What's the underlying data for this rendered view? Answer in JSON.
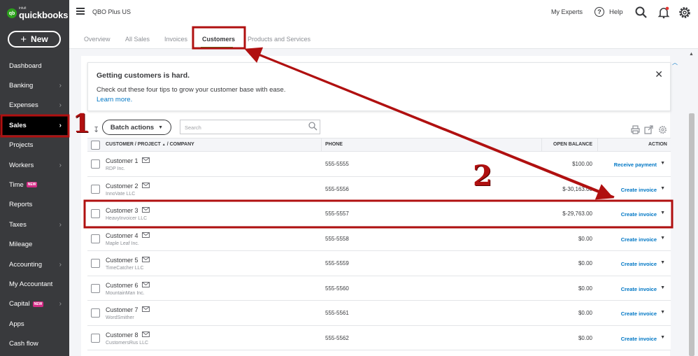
{
  "brand": {
    "logo_small": "intuit",
    "logo_big": "quickbooks"
  },
  "sidebar": {
    "new_label": "New",
    "items": [
      {
        "label": "Dashboard",
        "chevron": false,
        "badge": ""
      },
      {
        "label": "Banking",
        "chevron": true,
        "badge": ""
      },
      {
        "label": "Expenses",
        "chevron": true,
        "badge": ""
      },
      {
        "label": "Sales",
        "chevron": true,
        "badge": "",
        "active": true
      },
      {
        "label": "Projects",
        "chevron": false,
        "badge": ""
      },
      {
        "label": "Workers",
        "chevron": true,
        "badge": ""
      },
      {
        "label": "Time",
        "chevron": false,
        "badge": "NEW"
      },
      {
        "label": "Reports",
        "chevron": false,
        "badge": ""
      },
      {
        "label": "Taxes",
        "chevron": true,
        "badge": ""
      },
      {
        "label": "Mileage",
        "chevron": false,
        "badge": ""
      },
      {
        "label": "Accounting",
        "chevron": true,
        "badge": ""
      },
      {
        "label": "My Accountant",
        "chevron": false,
        "badge": ""
      },
      {
        "label": "Capital",
        "chevron": true,
        "badge": "NEW"
      },
      {
        "label": "Apps",
        "chevron": false,
        "badge": ""
      },
      {
        "label": "Cash flow",
        "chevron": false,
        "badge": ""
      }
    ]
  },
  "header": {
    "company_name": "QBO Plus US",
    "my_experts": "My Experts",
    "help_label": "Help",
    "help_glyph": "?"
  },
  "tabs": [
    "Overview",
    "All Sales",
    "Invoices",
    "Customers",
    "Products and Services"
  ],
  "banner": {
    "title": "Getting customers is hard.",
    "body": "Check out these four tips to grow your customer base with ease.",
    "link": "Learn more.",
    "close": "✕"
  },
  "toolbar": {
    "batch_actions": "Batch actions",
    "search_placeholder": "Search"
  },
  "table": {
    "headers": {
      "customer": "CUSTOMER / PROJECT",
      "sort_glyph": "▲",
      "company": "/ COMPANY",
      "phone": "PHONE",
      "balance": "OPEN BALANCE",
      "action": "ACTION"
    },
    "rows": [
      {
        "name": "Customer 1",
        "company": "RDP Inc.",
        "phone": "555-5555",
        "balance": "$100.00",
        "action": "Receive payment"
      },
      {
        "name": "Customer 2",
        "company": "InnoVate LLC",
        "phone": "555-5556",
        "balance": "$-30,163.00",
        "action": "Create invoice"
      },
      {
        "name": "Customer 3",
        "company": "HeavyInvoicer LLC",
        "phone": "555-5557",
        "balance": "$-29,763.00",
        "action": "Create invoice"
      },
      {
        "name": "Customer 4",
        "company": "Maple Leaf Inc.",
        "phone": "555-5558",
        "balance": "$0.00",
        "action": "Create invoice"
      },
      {
        "name": "Customer 5",
        "company": "TimeCatcher LLC",
        "phone": "555-5559",
        "balance": "$0.00",
        "action": "Create invoice"
      },
      {
        "name": "Customer 6",
        "company": "MountainMan Inc.",
        "phone": "555-5560",
        "balance": "$0.00",
        "action": "Create invoice"
      },
      {
        "name": "Customer 7",
        "company": "WordSmither",
        "phone": "555-5561",
        "balance": "$0.00",
        "action": "Create invoice"
      },
      {
        "name": "Customer 8",
        "company": "CustomersRus LLC",
        "phone": "555-5562",
        "balance": "$0.00",
        "action": "Create invoice"
      }
    ]
  },
  "annotations": {
    "number_1": "1",
    "number_2": "2"
  },
  "colors": {
    "brand_green": "#2ca01c",
    "link_blue": "#0077c5",
    "annotation_red": "#b01010",
    "sidebar_bg": "#393a3d"
  }
}
